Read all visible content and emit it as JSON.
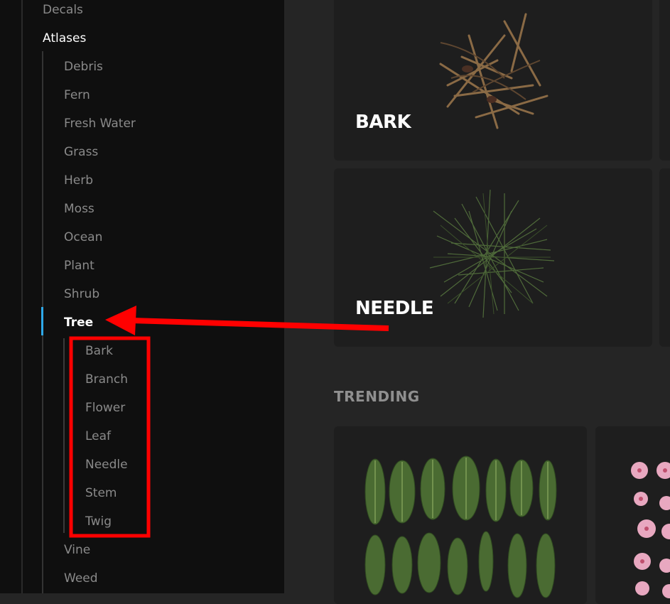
{
  "sidebar": {
    "top_items": [
      {
        "label": "Decals"
      },
      {
        "label": "Atlases"
      }
    ],
    "atlas_items": [
      {
        "label": "Debris"
      },
      {
        "label": "Fern"
      },
      {
        "label": "Fresh Water"
      },
      {
        "label": "Grass"
      },
      {
        "label": "Herb"
      },
      {
        "label": "Moss"
      },
      {
        "label": "Ocean"
      },
      {
        "label": "Plant"
      },
      {
        "label": "Shrub"
      },
      {
        "label": "Tree"
      }
    ],
    "tree_items": [
      {
        "label": "Bark"
      },
      {
        "label": "Branch"
      },
      {
        "label": "Flower"
      },
      {
        "label": "Leaf"
      },
      {
        "label": "Needle"
      },
      {
        "label": "Stem"
      },
      {
        "label": "Twig"
      }
    ],
    "after_items": [
      {
        "label": "Vine"
      },
      {
        "label": "Weed"
      }
    ],
    "active_color": "#2ea8e8"
  },
  "main": {
    "cards": [
      {
        "title": "BARK"
      },
      {
        "title": "NEEDLE"
      }
    ],
    "trending_title": "TRENDING"
  },
  "annotation": {
    "color": "#ff0000"
  }
}
